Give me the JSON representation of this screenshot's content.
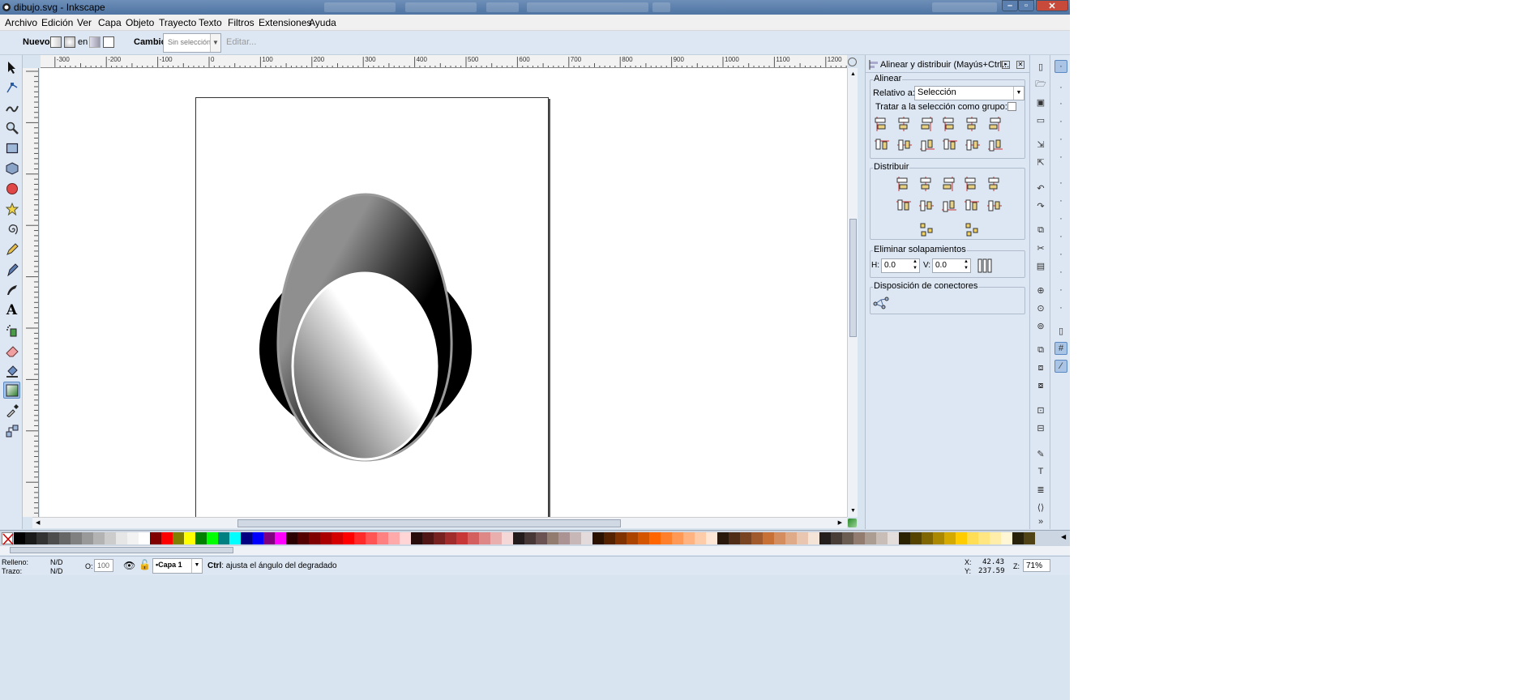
{
  "window": {
    "title": "dibujo.svg - Inkscape",
    "background_tabs": [
      "",
      "",
      "",
      "",
      "",
      ""
    ]
  },
  "menu": {
    "items": [
      "Archivo",
      "Edición",
      "Ver",
      "Capa",
      "Objeto",
      "Trayecto",
      "Texto",
      "Filtros",
      "Extensiones",
      "Ayuda"
    ]
  },
  "controls": {
    "nuevo_label": "Nuevo:",
    "en_label": "en",
    "cambio_label": "Cambio:",
    "selection_value": "Sin selección",
    "editar_label": "Editar..."
  },
  "ruler": {
    "h_ticks": [
      "-300",
      "-200",
      "-100",
      "0",
      "100",
      "200",
      "300",
      "400",
      "500",
      "600",
      "700",
      "800",
      "900",
      "1000",
      "1100",
      "1200"
    ],
    "v_ticks": [
      "0",
      "100",
      "200",
      "300",
      "400",
      "500",
      "600",
      "700",
      "800",
      "900",
      "1000"
    ]
  },
  "panel": {
    "title": "Alinear y distribuir (Mayús+Ctrl...",
    "alinear_title": "Alinear",
    "relativo_label": "Relativo a:",
    "relativo_value": "Selección",
    "grupo_label": "Tratar a la selección como grupo:",
    "distribuir_title": "Distribuir",
    "eliminar_title": "Eliminar solapamientos",
    "h_label": "H:",
    "h_value": "0.0",
    "v_label": "V:",
    "v_value": "0.0",
    "conectores_title": "Disposición de conectores"
  },
  "status": {
    "relleno_label": "Relleno:",
    "relleno_value": "N/D",
    "trazo_label": "Trazo:",
    "trazo_value": "N/D",
    "opacity_label": "O:",
    "opacity_value": "100",
    "layer_value": "•Capa 1",
    "message_bold": "Ctrl",
    "message": ": ajusta el ángulo del degradado",
    "x_label": "X:",
    "x_value": "42.43",
    "y_value": "237.59",
    "z_label": "Z:",
    "zoom_value": "71%"
  },
  "colors": {
    "accent": "#5a88c0",
    "toolbar_bg": "#dde7f3",
    "canvas_bg": "#ffffff"
  },
  "palette": [
    "#000000",
    "#1a1a1a",
    "#333333",
    "#4d4d4d",
    "#666666",
    "#808080",
    "#999999",
    "#b3b3b3",
    "#cccccc",
    "#e6e6e6",
    "#f2f2f2",
    "#ffffff",
    "#800000",
    "#ff0000",
    "#808000",
    "#ffff00",
    "#008000",
    "#00ff00",
    "#008080",
    "#00ffff",
    "#000080",
    "#0000ff",
    "#800080",
    "#ff00ff",
    "#2b0000",
    "#550000",
    "#800000",
    "#aa0000",
    "#d40000",
    "#ff0000",
    "#ff2a2a",
    "#ff5555",
    "#ff8080",
    "#ffaaaa",
    "#ffd5d5",
    "#280b0b",
    "#501616",
    "#782121",
    "#a02c2c",
    "#c83737",
    "#d35f5f",
    "#de8787",
    "#e9afaf",
    "#f4d7d7",
    "#241c1c",
    "#483737",
    "#6c5353",
    "#917c6f",
    "#ac9393",
    "#c8b7b7",
    "#e3dbdb",
    "#2b1100",
    "#552200",
    "#803300",
    "#aa4400",
    "#d45500",
    "#ff6600",
    "#ff7f2a",
    "#ff9955",
    "#ffb380",
    "#ffccaa",
    "#ffe6d5",
    "#28170b",
    "#502d16",
    "#784421",
    "#a05a2c",
    "#c87137",
    "#d38d5f",
    "#deaa87",
    "#e9c6af",
    "#f4e3d7",
    "#241f1c",
    "#483e37",
    "#6c5d53",
    "#917c6f",
    "#ac9d93",
    "#c8beb7",
    "#e3dedb",
    "#2b2200",
    "#554400",
    "#806600",
    "#aa8800",
    "#d4aa00",
    "#ffcc00",
    "#ffdd55",
    "#ffe680",
    "#ffeeaa",
    "#fff6d5",
    "#28220b",
    "#504416"
  ],
  "tools": {
    "left": [
      "selector-tool",
      "node-tool",
      "tweak-tool",
      "zoom-tool",
      "rect-tool",
      "3dbox-tool",
      "ellipse-tool",
      "star-tool",
      "spiral-tool",
      "pencil-tool",
      "pen-tool",
      "calligraphy-tool",
      "text-tool",
      "spray-tool",
      "eraser-tool",
      "bucket-tool",
      "gradient-tool",
      "dropper-tool",
      "connector-tool"
    ]
  }
}
